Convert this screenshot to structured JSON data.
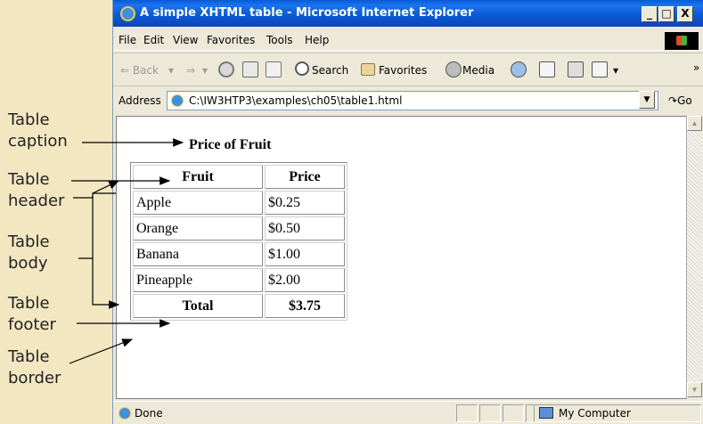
{
  "callouts": {
    "caption": [
      "Table",
      "caption"
    ],
    "header": [
      "Table",
      "header"
    ],
    "body": [
      "Table",
      "body"
    ],
    "footer": [
      "Table",
      "footer"
    ],
    "border": [
      "Table",
      "border"
    ]
  },
  "window": {
    "title": "A simple XHTML table - Microsoft Internet Explorer",
    "controls": {
      "minimize": "_",
      "maximize": "□",
      "close": "X"
    }
  },
  "menu": [
    "File",
    "Edit",
    "View",
    "Favorites",
    "Tools",
    "Help"
  ],
  "toolbar": {
    "back": "⇐ Back",
    "forward": "⇒",
    "search": "Search",
    "favorites": "Favorites",
    "media": "Media",
    "chevron": "»"
  },
  "address": {
    "label": "Address",
    "url": "C:\\IW3HTP3\\examples\\ch05\\table1.html",
    "go": "Go"
  },
  "page": {
    "caption": "Price of Fruit",
    "headers": [
      "Fruit",
      "Price"
    ],
    "rows": [
      [
        "Apple",
        "$0.25"
      ],
      [
        "Orange",
        "$0.50"
      ],
      [
        "Banana",
        "$1.00"
      ],
      [
        "Pineapple",
        "$2.00"
      ]
    ],
    "footer": [
      "Total",
      "$3.75"
    ]
  },
  "status": {
    "text": "Done",
    "zone": "My Computer"
  },
  "colors": {
    "background": "#f3e7c2",
    "titlebar": "#0a5ad8"
  }
}
